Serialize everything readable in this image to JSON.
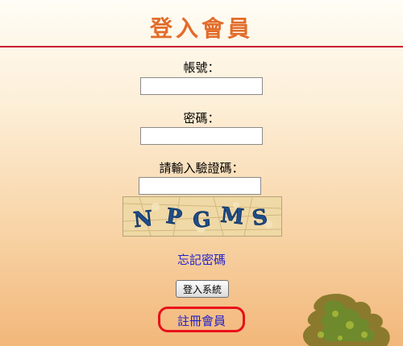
{
  "page": {
    "title": "登入會員"
  },
  "form": {
    "account_label": "帳號：",
    "account_value": "",
    "password_label": "密碼：",
    "password_value": "",
    "captcha_label": "請輸入驗證碼：",
    "captcha_value": "",
    "captcha_text": "NPGMS",
    "captcha_chars": [
      "N",
      "P",
      "G",
      "M",
      "S"
    ]
  },
  "links": {
    "forgot_password": "忘記密碼",
    "register": "註冊會員"
  },
  "buttons": {
    "login": "登入系統"
  },
  "colors": {
    "title": "#e26c2a",
    "rule": "#c8102e",
    "link": "#2222cc",
    "highlight_ring": "#e8101a",
    "captcha_text": "#1f4d8a"
  }
}
